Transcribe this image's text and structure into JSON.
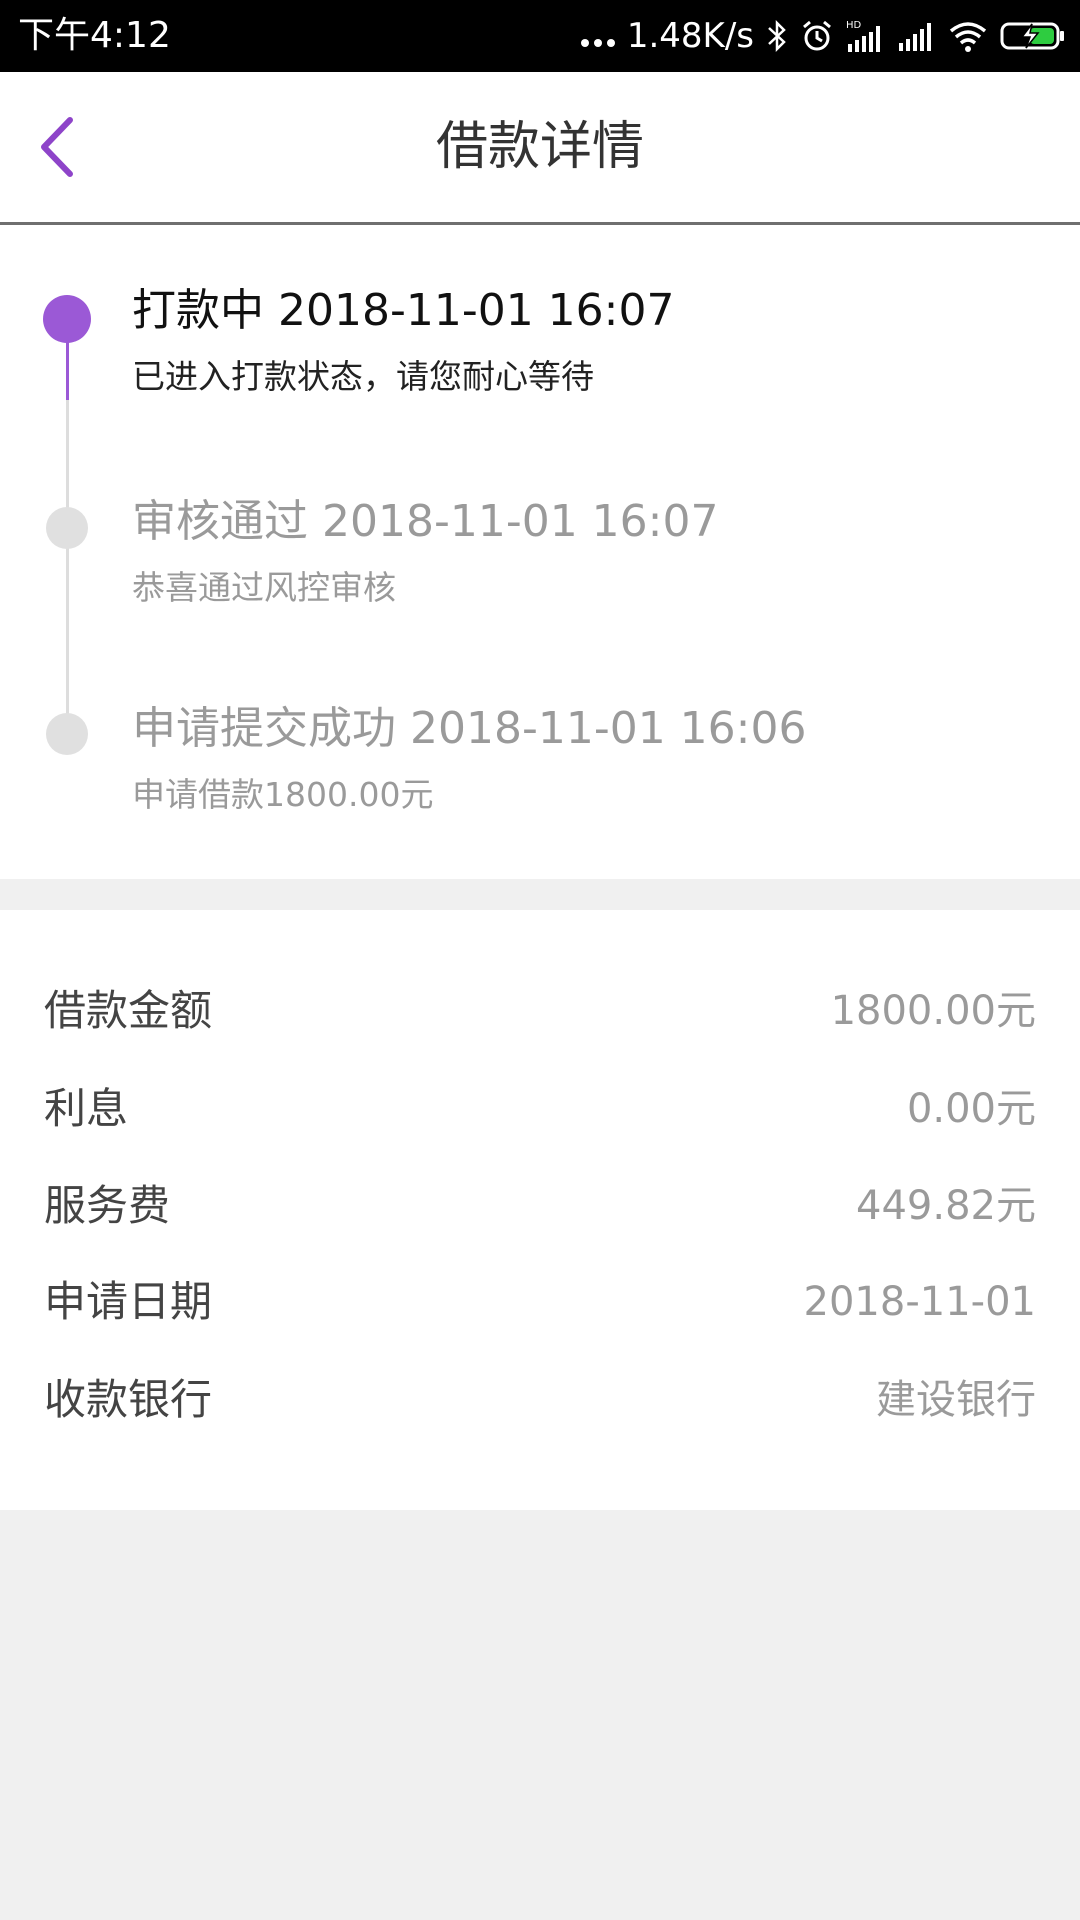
{
  "status_bar": {
    "time": "下午4:12",
    "network_speed": "1.48K/s",
    "icons": [
      "more-dots-icon",
      "bluetooth-icon",
      "alarm-icon",
      "hd-signal-icon",
      "signal-icon",
      "wifi-icon",
      "battery-charging-icon"
    ]
  },
  "header": {
    "title": "借款详情",
    "back_icon": "chevron-left-icon"
  },
  "accent_color": "#9b59d6",
  "timeline": [
    {
      "title": "打款中 2018-11-01 16:07",
      "desc": "已进入打款状态，请您耐心等待",
      "state": "active"
    },
    {
      "title": "审核通过 2018-11-01 16:07",
      "desc": "恭喜通过风控审核",
      "state": "done"
    },
    {
      "title": "申请提交成功 2018-11-01 16:06",
      "desc": "申请借款1800.00元",
      "state": "done"
    }
  ],
  "details": [
    {
      "label": "借款金额",
      "value": "1800.00元"
    },
    {
      "label": "利息",
      "value": "0.00元"
    },
    {
      "label": "服务费",
      "value": "449.82元"
    },
    {
      "label": "申请日期",
      "value": "2018-11-01"
    },
    {
      "label": "收款银行",
      "value": "建设银行"
    }
  ]
}
